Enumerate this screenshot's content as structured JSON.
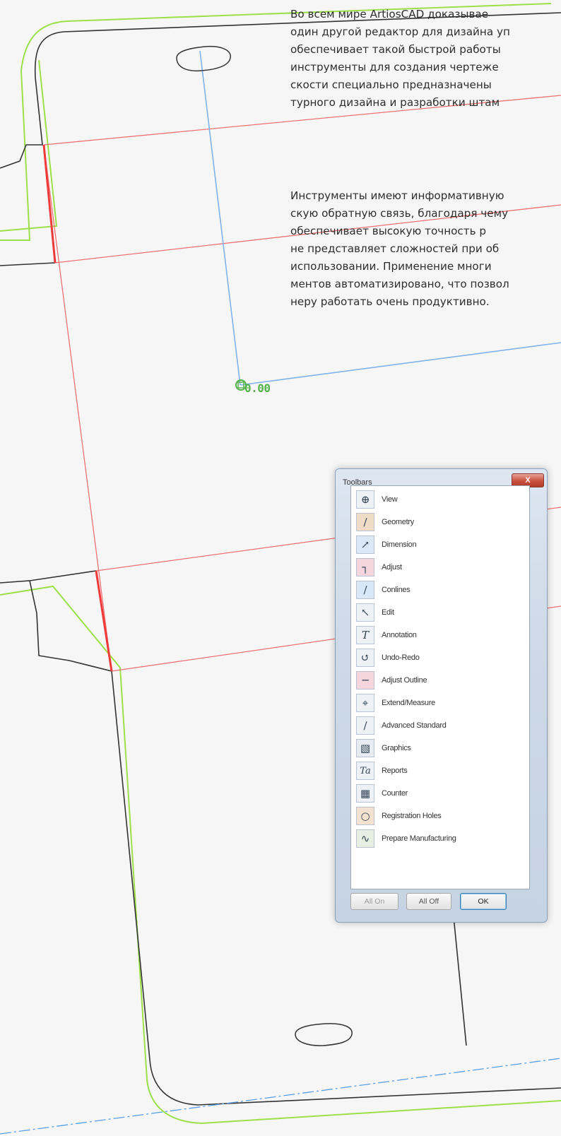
{
  "paragraph1": [
    "Во всем мире ArtiosCAD доказывае",
    "один другой редактор для дизайна уп",
    "обеспечивает такой быстрой работы",
    "инструменты для создания чертеже",
    "скости специально предназначены",
    "турного дизайна и разработки штам"
  ],
  "paragraph2": [
    "Инструменты имеют информативную",
    "скую обратную связь, благодаря чему",
    "обеспечивает высокую точность р",
    "не представляет сложностей при об",
    "использовании. Применение многи",
    "ментов автоматизировано, что позвол",
    "неру работать очень продуктивно."
  ],
  "dimension_label": "0.00",
  "dialog": {
    "title": "Toolbars",
    "close_label": "X",
    "items": [
      {
        "label": "View",
        "icon": "magnifier-icon"
      },
      {
        "label": "Geometry",
        "icon": "geometry-line-icon"
      },
      {
        "label": "Dimension",
        "icon": "dimension-arrow-icon"
      },
      {
        "label": "Adjust",
        "icon": "adjust-corner-icon"
      },
      {
        "label": "Conlines",
        "icon": "conline-icon"
      },
      {
        "label": "Edit",
        "icon": "pointer-arrow-icon"
      },
      {
        "label": "Annotation",
        "icon": "text-t-icon"
      },
      {
        "label": "Undo-Redo",
        "icon": "undo-arrow-icon"
      },
      {
        "label": "Adjust Outline",
        "icon": "adjust-outline-icon"
      },
      {
        "label": "Extend/Measure",
        "icon": "extend-measure-icon"
      },
      {
        "label": "Advanced Standard",
        "icon": "diagonal-line-icon"
      },
      {
        "label": "Graphics",
        "icon": "graphics-icon"
      },
      {
        "label": "Reports",
        "icon": "reports-ta-icon"
      },
      {
        "label": "Counter",
        "icon": "counter-icon"
      },
      {
        "label": "Registration Holes",
        "icon": "registration-hole-icon"
      },
      {
        "label": "Prepare Manufacturing",
        "icon": "prepare-manufacturing-icon"
      }
    ],
    "buttons": {
      "all_on": "All On",
      "all_off": "All Off",
      "ok": "OK"
    }
  }
}
